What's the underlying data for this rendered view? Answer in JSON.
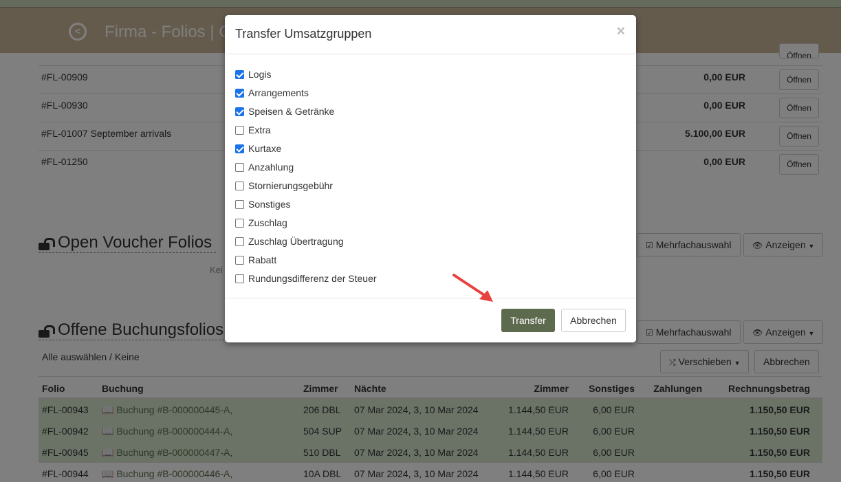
{
  "header": {
    "title": "Firma - Folios | C"
  },
  "folios": [
    {
      "id": "#FL-00909",
      "amount": "0,00 EUR",
      "button": "Öffnen"
    },
    {
      "id": "#FL-00930",
      "amount": "0,00 EUR",
      "button": "Öffnen"
    },
    {
      "id": "#FL-01007 September arrivals",
      "amount": "5.100,00 EUR",
      "button": "Öffnen"
    },
    {
      "id": "#FL-01250",
      "amount": "0,00 EUR",
      "button": "Öffnen"
    }
  ],
  "top_partial_button": "Öffnen",
  "voucher": {
    "title": "Open Voucher Folios",
    "multi": "Mehrfachauswahl",
    "show": "Anzeigen",
    "empty_partial": "Kei"
  },
  "booking": {
    "title": "Offene Buchungsfolios",
    "multi": "Mehrfachauswahl",
    "show": "Anzeigen",
    "select_all": "Alle auswählen / Keine",
    "move": "Verschieben",
    "cancel": "Abbrechen"
  },
  "table": {
    "headers": [
      "Folio",
      "Buchung",
      "Zimmer",
      "Nächte",
      "Zimmer",
      "Sonstiges",
      "Zahlungen",
      "Rechnungsbetrag"
    ],
    "rows": [
      {
        "folio": "#FL-00943",
        "booking": "Buchung #B-000000445-A,",
        "room": "206 DBL",
        "nights": "07 Mar 2024, 3, 10 Mar 2024",
        "room_amount": "1.144,50 EUR",
        "other": "6,00 EUR",
        "payments": "",
        "total": "1.150,50 EUR",
        "selected": true
      },
      {
        "folio": "#FL-00942",
        "booking": "Buchung #B-000000444-A,",
        "room": "504 SUP",
        "nights": "07 Mar 2024, 3, 10 Mar 2024",
        "room_amount": "1.144,50 EUR",
        "other": "6,00 EUR",
        "payments": "",
        "total": "1.150,50 EUR",
        "selected": true
      },
      {
        "folio": "#FL-00945",
        "booking": "Buchung #B-000000447-A,",
        "room": "510 DBL",
        "nights": "07 Mar 2024, 3, 10 Mar 2024",
        "room_amount": "1.144,50 EUR",
        "other": "6,00 EUR",
        "payments": "",
        "total": "1.150,50 EUR",
        "selected": true
      },
      {
        "folio": "#FL-00944",
        "booking": "Buchung #B-000000446-A,",
        "room": "10A DBL",
        "nights": "07 Mar 2024, 3, 10 Mar 2024",
        "room_amount": "1.144,50 EUR",
        "other": "6,00 EUR",
        "payments": "",
        "total": "1.150,50 EUR",
        "selected": false
      }
    ]
  },
  "modal": {
    "title": "Transfer Umsatzgruppen",
    "close": "×",
    "options": [
      {
        "label": "Logis",
        "checked": true
      },
      {
        "label": "Arrangements",
        "checked": true
      },
      {
        "label": "Speisen & Getränke",
        "checked": true
      },
      {
        "label": "Extra",
        "checked": false
      },
      {
        "label": "Kurtaxe",
        "checked": true
      },
      {
        "label": "Anzahlung",
        "checked": false
      },
      {
        "label": "Stornierungsgebühr",
        "checked": false
      },
      {
        "label": "Sonstiges",
        "checked": false
      },
      {
        "label": "Zuschlag",
        "checked": false
      },
      {
        "label": "Zuschlag Übertragung",
        "checked": false
      },
      {
        "label": "Rabatt",
        "checked": false
      },
      {
        "label": "Rundungsdifferenz der Steuer",
        "checked": false
      }
    ],
    "transfer": "Transfer",
    "cancel": "Abbrechen"
  },
  "colors": {
    "header": "#c8b69a",
    "primary_button": "#5e6a4e",
    "checkbox": "#1a73e8",
    "annotation_arrow": "#e8413e"
  }
}
